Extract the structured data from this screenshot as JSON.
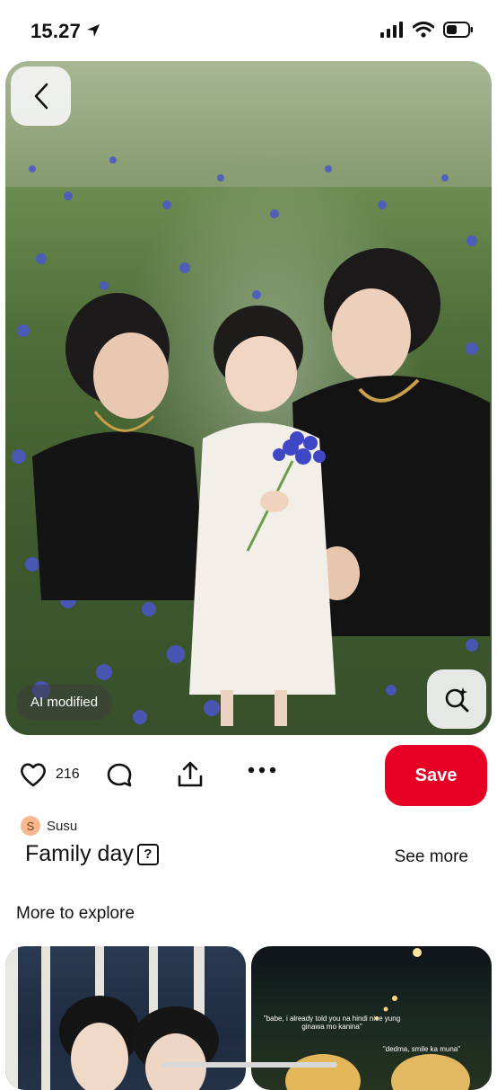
{
  "status_bar": {
    "time": "15.27"
  },
  "pin": {
    "ai_badge": "AI modified",
    "likes": "216",
    "save_label": "Save",
    "author_initial": "S",
    "author_name": "Susu",
    "title": "Family day",
    "help_mark": "?",
    "see_more": "See more"
  },
  "explore": {
    "heading": "More to explore",
    "card2_caption1": "\"babe, i already told you na hindi nice yung ginawa mo kanina\"",
    "card2_caption2": "\"dedma, smile ka muna\""
  },
  "colors": {
    "accent": "#e60023"
  }
}
